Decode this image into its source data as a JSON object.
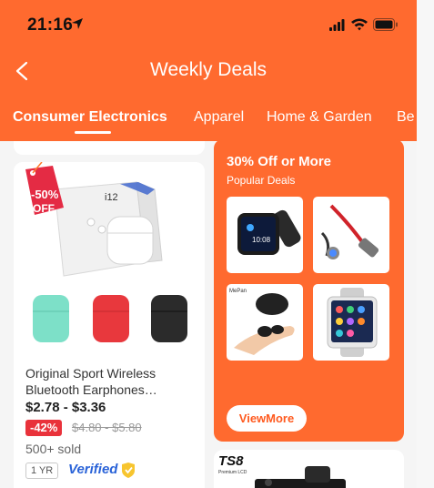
{
  "status_bar": {
    "time": "21:16"
  },
  "header": {
    "title": "Weekly Deals",
    "tabs": [
      {
        "label": "Consumer Electronics",
        "active": true
      },
      {
        "label": "Apparel",
        "active": false
      },
      {
        "label": "Home & Garden",
        "active": false
      },
      {
        "label": "Be",
        "active": false
      }
    ]
  },
  "product": {
    "badge_text": "-50%",
    "badge_sub": "OFF",
    "box_label": "i12",
    "title": "Original Sport Wireless Bluetooth Earphones…",
    "price": "$2.78 - $3.36",
    "discount": "-42%",
    "old_price": "$4.80 - $5.80",
    "sold": "500+ sold",
    "warranty": "1 YR",
    "verified": "Verified"
  },
  "deals": {
    "title": "30% Off or More",
    "subtitle": "Popular Deals",
    "tile_brand": "MePan",
    "button": "ViewMore"
  },
  "next_card": {
    "title": "TS8",
    "subtitle": "Premium LCD"
  },
  "colors": {
    "brand_orange": "#ff6a2f",
    "discount_red": "#e9323b",
    "verified_blue": "#2a63d8"
  }
}
